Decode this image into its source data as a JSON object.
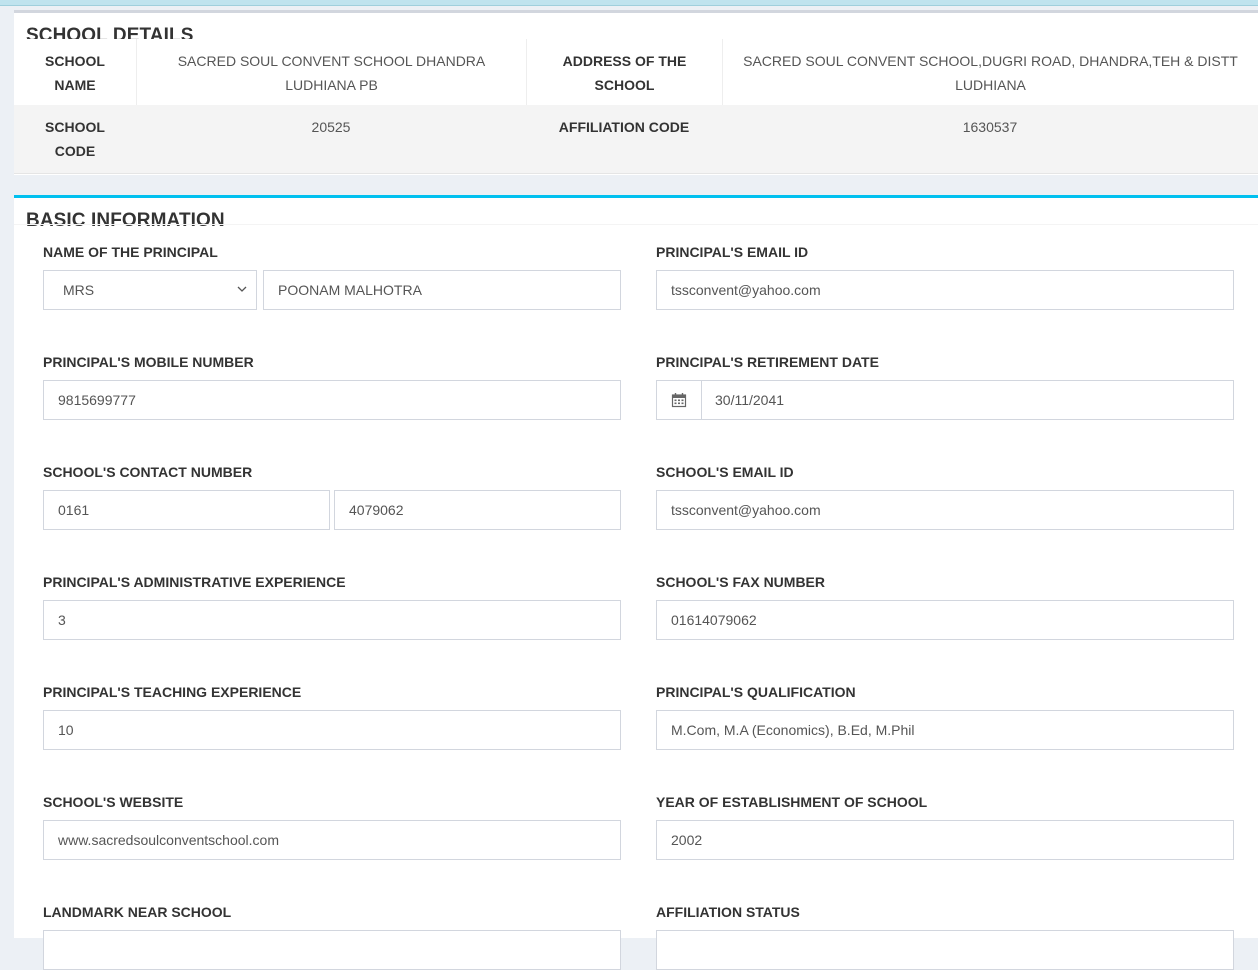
{
  "school_details": {
    "title": "SCHOOL DETAILS",
    "school_name_label": "SCHOOL NAME",
    "school_name": "SACRED SOUL CONVENT SCHOOL DHANDRA LUDHIANA PB",
    "address_label": "ADDRESS OF THE SCHOOL",
    "address": "SACRED SOUL CONVENT SCHOOL,DUGRI ROAD, DHANDRA,TEH & DISTT LUDHIANA",
    "school_code_label": "SCHOOL CODE",
    "school_code": "20525",
    "affiliation_code_label": "AFFILIATION CODE",
    "affiliation_code": "1630537"
  },
  "basic_info": {
    "title": "BASIC INFORMATION",
    "principal_name": {
      "label": "NAME OF THE PRINCIPAL",
      "salutation": "MRS",
      "name": "POONAM MALHOTRA"
    },
    "principal_email": {
      "label": "PRINCIPAL'S EMAIL ID",
      "value": "tssconvent@yahoo.com"
    },
    "principal_mobile": {
      "label": "PRINCIPAL'S MOBILE NUMBER",
      "value": "9815699777"
    },
    "retirement_date": {
      "label": "PRINCIPAL'S RETIREMENT DATE",
      "value": "30/11/2041",
      "icon": "calendar-icon"
    },
    "school_contact": {
      "label": "SCHOOL'S CONTACT NUMBER",
      "std_code": "0161",
      "number": "4079062"
    },
    "school_email": {
      "label": "SCHOOL'S EMAIL ID",
      "value": "tssconvent@yahoo.com"
    },
    "admin_experience": {
      "label": "PRINCIPAL'S ADMINISTRATIVE EXPERIENCE",
      "value": "3"
    },
    "fax": {
      "label": "SCHOOL'S FAX NUMBER",
      "value": "01614079062"
    },
    "teaching_experience": {
      "label": "PRINCIPAL'S TEACHING EXPERIENCE",
      "value": "10"
    },
    "qualification": {
      "label": "PRINCIPAL'S QUALIFICATION",
      "value": "M.Com, M.A (Economics), B.Ed, M.Phil"
    },
    "website": {
      "label": "SCHOOL'S WEBSITE",
      "value": "www.sacredsoulconventschool.com"
    },
    "establishment_year": {
      "label": "YEAR OF ESTABLISHMENT OF SCHOOL",
      "value": "2002"
    },
    "landmark": {
      "label": "LANDMARK NEAR SCHOOL"
    },
    "affiliation_status": {
      "label": "AFFILIATION STATUS"
    }
  },
  "colors": {
    "accent": "#00c0ef",
    "page_bg": "#ecf0f5",
    "border": "#d2d6de"
  }
}
